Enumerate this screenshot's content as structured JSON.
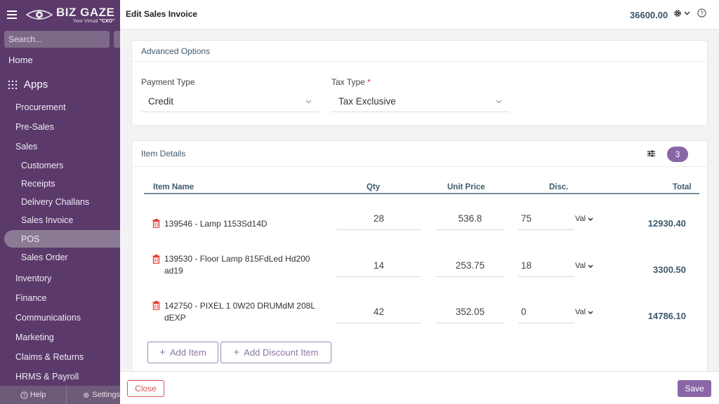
{
  "sidebar": {
    "logo_name": "BIZ GAZE",
    "logo_tagline_prefix": "Your Virtual ",
    "logo_tagline_cxo": "\"CXO\"",
    "search_placeholder": "Search...",
    "home": "Home",
    "apps": "Apps",
    "items": [
      {
        "label": "Procurement"
      },
      {
        "label": "Pre-Sales"
      },
      {
        "label": "Sales"
      },
      {
        "label": "Customers"
      },
      {
        "label": "Receipts"
      },
      {
        "label": "Delivery Challans"
      },
      {
        "label": "Sales Invoice"
      },
      {
        "label": "POS"
      },
      {
        "label": "Sales Order"
      },
      {
        "label": "Inventory"
      },
      {
        "label": "Finance"
      },
      {
        "label": "Communications"
      },
      {
        "label": "Marketing"
      },
      {
        "label": "Claims & Returns"
      },
      {
        "label": "HRMS & Payroll"
      }
    ],
    "help_label": "Help",
    "settings_label": "Settings"
  },
  "header": {
    "title": "Edit Sales Invoice",
    "total": "36600.00"
  },
  "advanced": {
    "title": "Advanced Options",
    "payment_type_label": "Payment Type",
    "payment_type_value": "Credit",
    "tax_type_label": "Tax Type",
    "tax_type_required": "*",
    "tax_type_value": "Tax Exclusive"
  },
  "items": {
    "title": "Item Details",
    "count": "3",
    "columns": {
      "name": "Item Name",
      "qty": "Qty",
      "price": "Unit Price",
      "disc": "Disc.",
      "total": "Total"
    },
    "rows": [
      {
        "name": "139546 - Lamp 1153Sd14D",
        "qty": "28",
        "price": "536.8",
        "disc": "75",
        "disc_type": "Val",
        "total": "12930.40"
      },
      {
        "name": "139530 - Floor Lamp 815FdLed Hd200 ad19",
        "qty": "14",
        "price": "253.75",
        "disc": "18",
        "disc_type": "Val",
        "total": "3300.50"
      },
      {
        "name": "142750 - PIXEL 1 0W20 DRUMdM 208L dEXP",
        "qty": "42",
        "price": "352.05",
        "disc": "0",
        "disc_type": "Val",
        "total": "14786.10"
      }
    ],
    "add_item": "Add Item",
    "add_discount_item": "Add Discount Item"
  },
  "footer": {
    "close": "Close",
    "save": "Save"
  },
  "colors": {
    "sidebar_bg": "#5b3a6b",
    "accent": "#8a66a6",
    "danger": "#d9534f",
    "heading_blue": "#3d5a6c"
  }
}
